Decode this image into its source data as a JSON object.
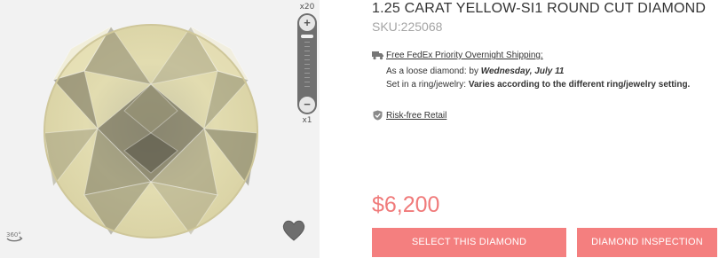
{
  "viewer": {
    "zoom_max_label": "x20",
    "zoom_min_label": "x1",
    "zoom_in_symbol": "+",
    "zoom_out_symbol": "−",
    "rotate_label": "360°",
    "icons": [
      "rotate-360-icon",
      "heart-icon",
      "zoom-in-icon",
      "zoom-out-icon"
    ]
  },
  "product": {
    "title": "1.25 CARAT YELLOW-SI1 ROUND CUT DIAMOND",
    "sku": "SKU:225068"
  },
  "shipping": {
    "link_label": "Free FedEx Priority Overnight Shipping:",
    "loose_prefix": "As a loose diamond: by",
    "loose_date": "Wednesday, July 11",
    "ring_prefix": "Set in a ring/jewelry:",
    "ring_value": "Varies according to the different ring/jewelry setting."
  },
  "risk": {
    "label": "Risk-free Retail"
  },
  "price": "$6,200",
  "buttons": {
    "select": "SELECT THIS DIAMOND",
    "inspect": "DIAMOND INSPECTION"
  },
  "colors": {
    "accent": "#f47f7f",
    "price": "#f07a7a",
    "sku": "#a5a5a5"
  }
}
